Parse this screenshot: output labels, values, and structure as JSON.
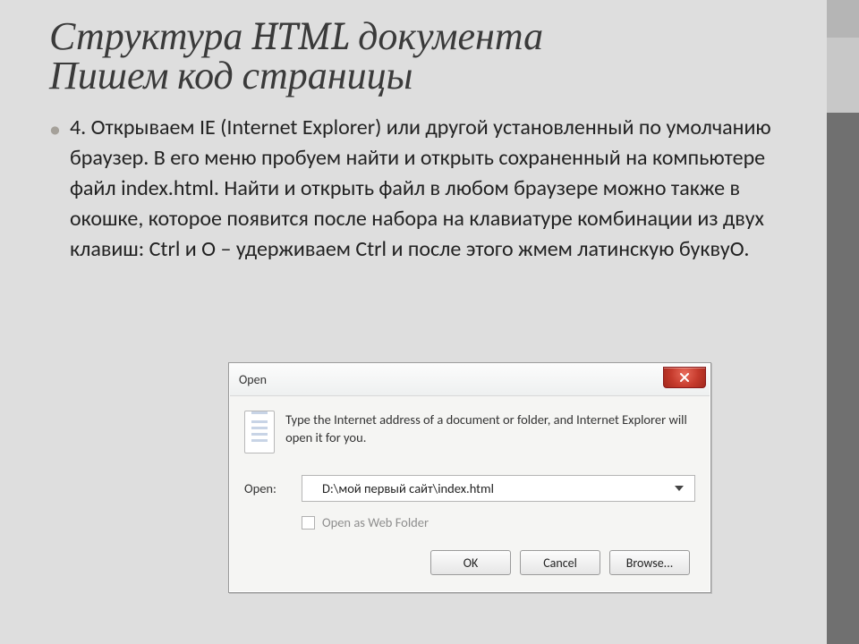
{
  "slide": {
    "title1": "Структура HTML документа",
    "title2": "Пишем код страницы",
    "bullet": "4. Открываем IE (Internet Explorer) или другой установленный по умолчанию браузер. В его меню пробуем найти и открыть сохраненный на компьютере файл index.html. Найти и открыть файл в любом браузере можно также в окошке, которое появится после набора на клавиатуре комбинации из двух клавиш: Ctrl и O – удерживаем Ctrl и после этого жмем латинскую буквуO."
  },
  "dialog": {
    "title": "Open",
    "info": "Type the Internet address of a document or folder, and Internet Explorer will open it for you.",
    "open_label": "Open:",
    "open_value": "D:\\мой первый сайт\\index.html",
    "webfolder_label": "Open as Web Folder",
    "buttons": {
      "ok": "OK",
      "cancel": "Cancel",
      "browse": "Browse..."
    }
  }
}
